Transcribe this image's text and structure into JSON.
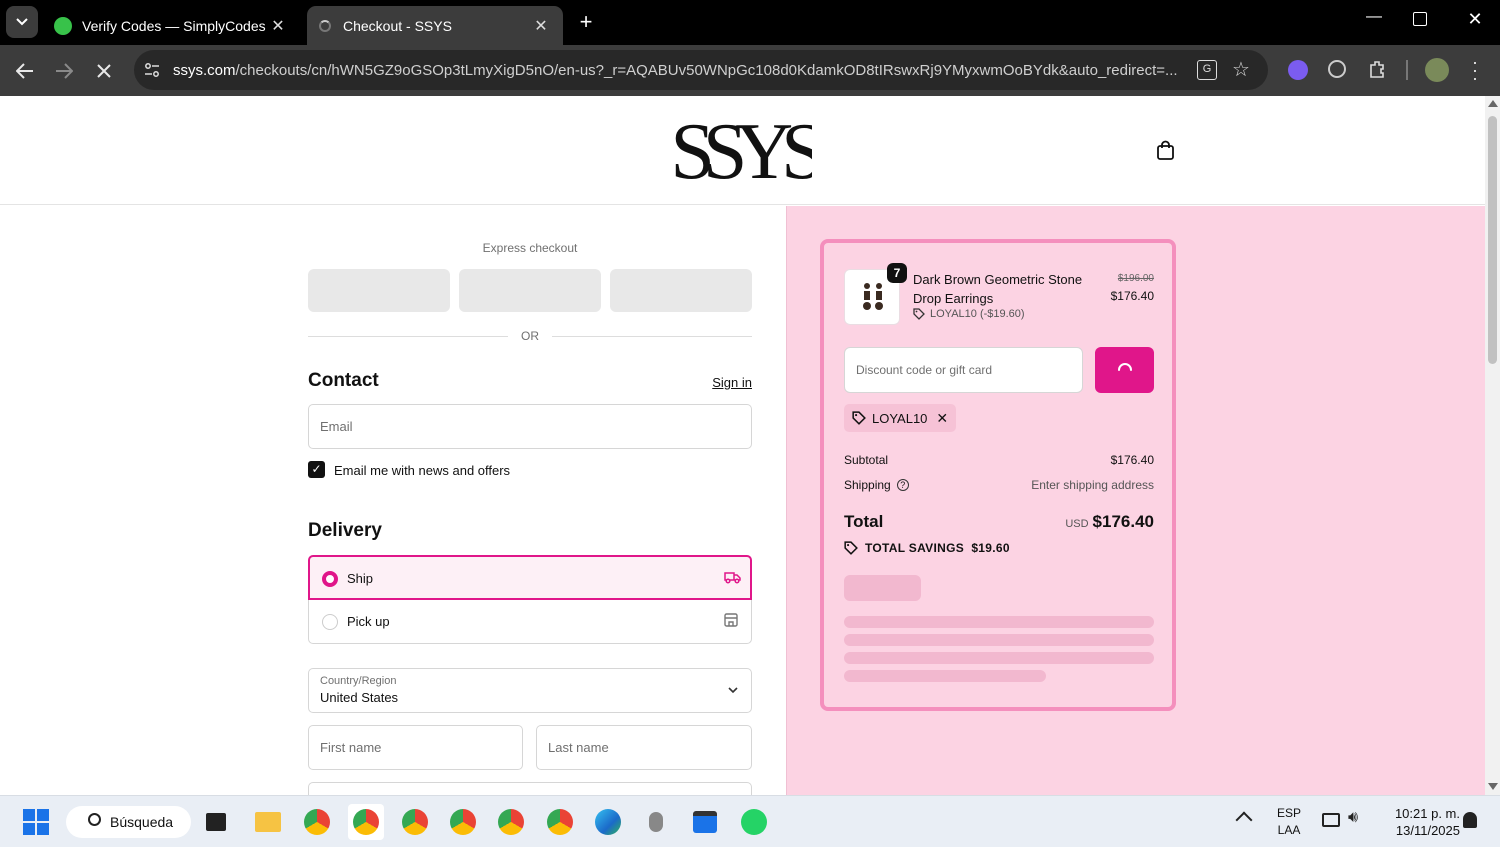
{
  "browser": {
    "tabs": [
      {
        "title": "Verify Codes — SimplyCodes",
        "active": false,
        "favicon": "simplycodes-icon"
      },
      {
        "title": "Checkout - SSYS",
        "active": true,
        "favicon": "loading-favicon"
      }
    ],
    "url_domain": "ssys.com",
    "url_path": "/checkouts/cn/hWN5GZ9oGSOp3tLmyXigD5nO/en-us?_r=AQABUv50WNpGc108d0KdamkOD8tIRswxRj9YMyxwmOoBYdk&auto_redirect=..."
  },
  "store": {
    "logo_text": "SSYS"
  },
  "checkout": {
    "express_label": "Express checkout",
    "or_label": "OR",
    "contact_title": "Contact",
    "sign_in": "Sign in",
    "email_placeholder": "Email",
    "newsletter_label": "Email me with news and offers",
    "newsletter_checked": true,
    "delivery_title": "Delivery",
    "ship_label": "Ship",
    "pickup_label": "Pick up",
    "country_label": "Country/Region",
    "country_value": "United States",
    "first_name_placeholder": "First name",
    "last_name_placeholder": "Last name"
  },
  "summary": {
    "item": {
      "name_line1": "Dark Brown Geometric Stone",
      "name_line2": "Drop Earrings",
      "quantity": "7",
      "discount": "LOYAL10 (-$19.60)",
      "original_price": "$196.00",
      "price": "$176.40"
    },
    "discount_placeholder": "Discount code or gift card",
    "applied_code": "LOYAL10",
    "subtotal_label": "Subtotal",
    "subtotal_value": "$176.40",
    "shipping_label": "Shipping",
    "shipping_value": "Enter shipping address",
    "total_label": "Total",
    "currency": "USD",
    "total_value": "$176.40",
    "savings_label": "TOTAL SAVINGS",
    "savings_value": "$19.60"
  },
  "taskbar": {
    "search": "Búsqueda",
    "lang1": "ESP",
    "lang2": "LAA",
    "time": "10:21 p. m.",
    "date": "13/11/2025"
  },
  "colors": {
    "accent": "#e0168a",
    "panel_bg": "#fcd3e3",
    "card_border": "#f48fbd"
  }
}
